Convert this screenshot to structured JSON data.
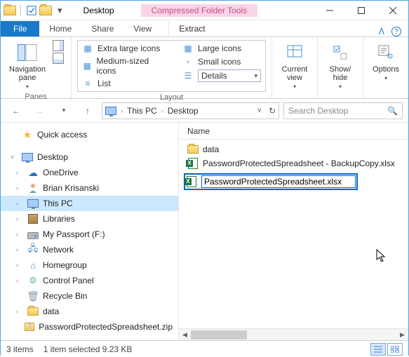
{
  "titlebar": {
    "title": "Desktop",
    "context_label": "Compressed Folder Tools"
  },
  "tabs": {
    "file": "File",
    "home": "Home",
    "share": "Share",
    "view": "View",
    "extract": "Extract"
  },
  "ribbon": {
    "panes": {
      "nav_label": "Navigation\npane",
      "group_label": "Panes"
    },
    "layout": {
      "extra_large": "Extra large icons",
      "large": "Large icons",
      "medium": "Medium-sized icons",
      "small": "Small icons",
      "list": "List",
      "details": "Details",
      "group_label": "Layout"
    },
    "current_view": "Current\nview",
    "show_hide": "Show/\nhide",
    "options": "Options"
  },
  "address": {
    "crumbs": [
      "This PC",
      "Desktop"
    ],
    "search_placeholder": "Search Desktop"
  },
  "tree": {
    "quick_access": "Quick access",
    "desktop": "Desktop",
    "items": [
      "OneDrive",
      "Brian Krisanski",
      "This PC",
      "Libraries",
      "My Passport (F:)",
      "Network",
      "Homegroup",
      "Control Panel",
      "Recycle Bin",
      "data",
      "PasswordProtectedSpreadsheet.zip"
    ]
  },
  "list": {
    "header_name": "Name",
    "items": [
      {
        "name": "data",
        "type": "folder"
      },
      {
        "name": "PasswordProtectedSpreadsheet - BackupCopy.xlsx",
        "type": "xlsx"
      }
    ],
    "rename_value": "PasswordProtectedSpreadsheet.xlsx"
  },
  "status": {
    "count": "3 items",
    "selected": "1 item selected  9.23 KB"
  }
}
